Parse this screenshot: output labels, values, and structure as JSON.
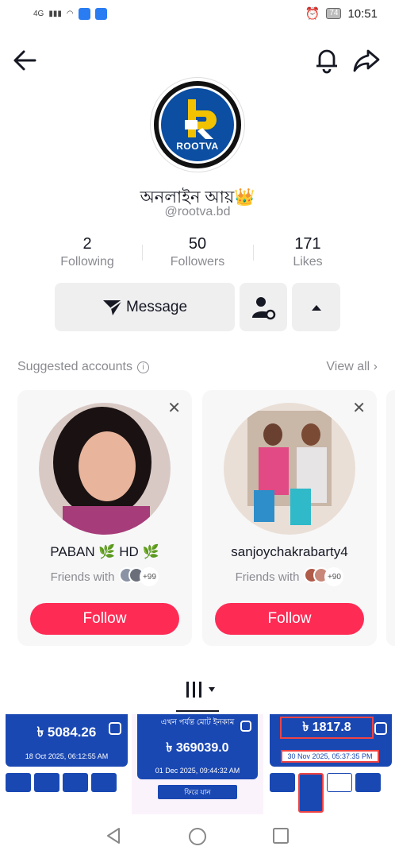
{
  "status": {
    "network": "4G",
    "battery": "74",
    "time": "10:51"
  },
  "icons": {
    "back": "back-arrow-icon",
    "bell": "bell-icon",
    "share": "share-icon"
  },
  "profile": {
    "avatar_text": "ROOTVA",
    "nickname": "অনলাইন আয়👑",
    "handle": "@rootva.bd",
    "stats": [
      {
        "value": "2",
        "label": "Following"
      },
      {
        "value": "50",
        "label": "Followers"
      },
      {
        "value": "171",
        "label": "Likes"
      }
    ]
  },
  "actions": {
    "message": "Message"
  },
  "suggested": {
    "title": "Suggested accounts",
    "view_all": "View all",
    "cards": [
      {
        "name": "PABAN 🌿 HD 🌿",
        "friends": "Friends with",
        "count": "+99",
        "follow": "Follow"
      },
      {
        "name": "sanjoychakrabarty4",
        "friends": "Friends with",
        "count": "+90",
        "follow": "Follow"
      }
    ]
  },
  "videos": [
    {
      "amount": "৳ 5084.26",
      "date": "18 Oct 2025, 06:12:55 AM"
    },
    {
      "header": "এখন পর্যন্ত মোট ইনকাম",
      "amount": "৳ 369039.0",
      "date": "01 Dec 2025, 09:44:32 AM",
      "button": "ফিরে যান"
    },
    {
      "amount": "৳ 1817.8",
      "date": "30 Nov 2025, 05:37:35 PM"
    }
  ],
  "colors": {
    "accent": "#fe2c55",
    "brand_blue": "#0b4ea2",
    "logo_yellow": "#f2c200"
  }
}
